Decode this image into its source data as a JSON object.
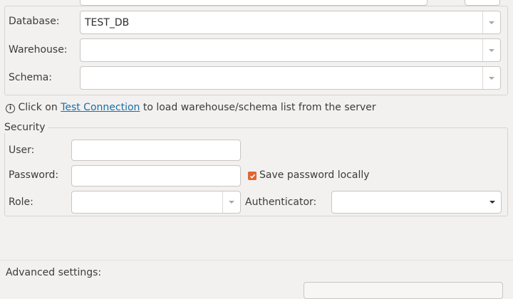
{
  "connection": {
    "database_label": "Database:",
    "database_value": "TEST_DB",
    "warehouse_label": "Warehouse:",
    "warehouse_value": "",
    "schema_label": "Schema:",
    "schema_value": ""
  },
  "info": {
    "icon": "info-icon",
    "prefix": "Click on",
    "link": "Test Connection",
    "suffix": "to load warehouse/schema list from the server"
  },
  "security": {
    "title": "Security",
    "user_label": "User:",
    "user_value": "",
    "password_label": "Password:",
    "password_value": "",
    "save_password_label": "Save password locally",
    "save_password_checked": true,
    "role_label": "Role:",
    "role_value": "",
    "authenticator_label": "Authenticator:",
    "authenticator_value": ""
  },
  "advanced": {
    "label": "Advanced settings:"
  },
  "colors": {
    "link": "#1a6ea8",
    "checkbox": "#e0662f"
  }
}
